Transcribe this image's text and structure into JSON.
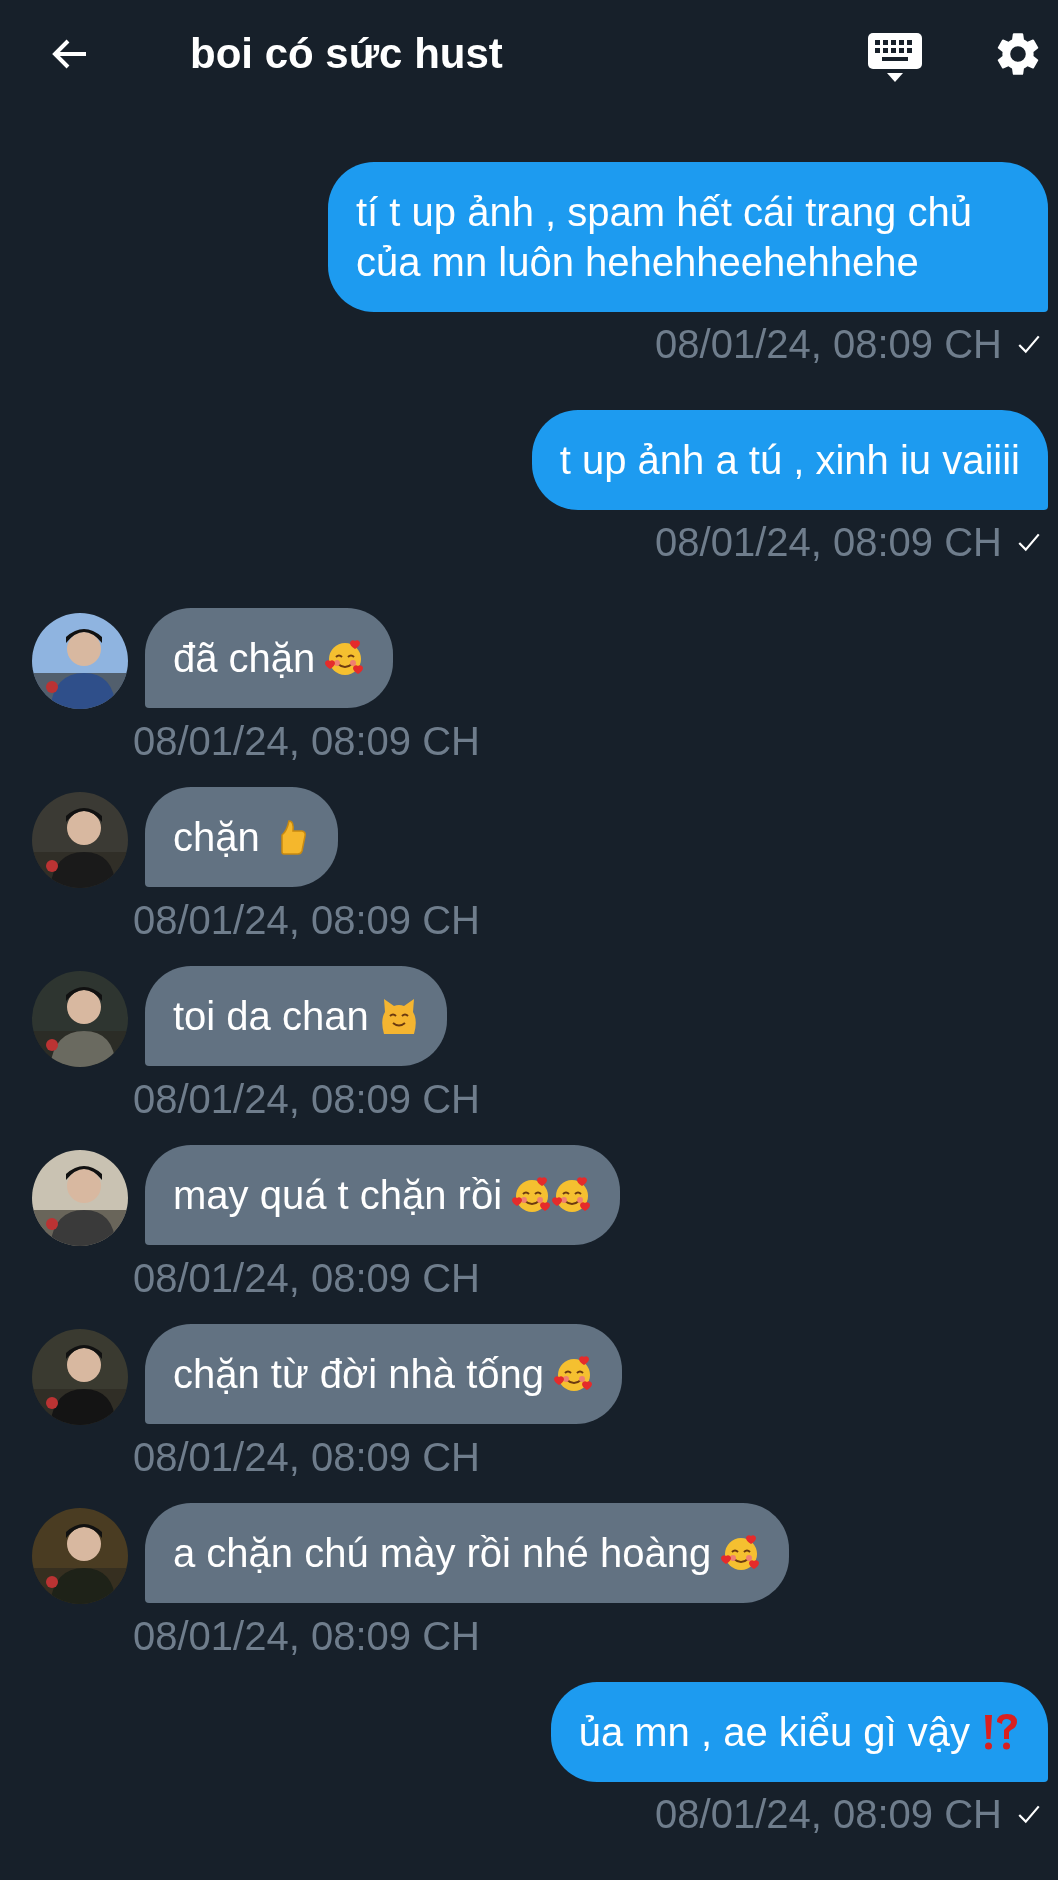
{
  "header": {
    "title": "boi có sức hust"
  },
  "messages": [
    {
      "kind": "outgoing",
      "text": "tí t up ảnh , spam hết cái trang chủ của mn luôn hehehheehehhehe",
      "time": "08/01/24, 08:09 CH",
      "check": true
    },
    {
      "kind": "outgoing",
      "text": "t up ảnh a tú , xinh iu vaiiii",
      "time": "08/01/24, 08:09 CH",
      "check": true
    },
    {
      "kind": "incoming",
      "text": "đã chặn",
      "emojis": [
        {
          "kind": "hearts-face"
        }
      ],
      "avatar": {
        "kind": "picture"
      },
      "time": "08/01/24, 08:09 CH"
    },
    {
      "kind": "incoming",
      "text": "chặn",
      "emojis": [
        {
          "kind": "thumbs-up"
        }
      ],
      "avatar": {
        "kind": "picture"
      },
      "time": "08/01/24, 08:09 CH"
    },
    {
      "kind": "incoming",
      "text": "toi da chan",
      "emojis": [
        {
          "kind": "cat-face"
        }
      ],
      "avatar": {
        "kind": "picture"
      },
      "time": "08/01/24, 08:09 CH"
    },
    {
      "kind": "incoming",
      "text": "may quá t chặn rồi",
      "emojis": [
        {
          "kind": "hearts-face"
        },
        {
          "kind": "hearts-face"
        }
      ],
      "avatar": {
        "kind": "picture"
      },
      "time": "08/01/24, 08:09 CH"
    },
    {
      "kind": "incoming",
      "text": "chặn từ đời nhà tống",
      "emojis": [
        {
          "kind": "hearts-face"
        }
      ],
      "avatar": {
        "kind": "picture"
      },
      "time": "08/01/24, 08:09 CH"
    },
    {
      "kind": "incoming",
      "text": "a chặn chú mày rồi nhé hoàng",
      "emojis": [
        {
          "kind": "hearts-face"
        }
      ],
      "avatar": {
        "kind": "picture"
      },
      "time": "08/01/24, 08:09 CH"
    },
    {
      "kind": "outgoing",
      "text": "ủa mn , ae kiểu gì vậy",
      "emojis": [
        {
          "kind": "exclamation-question"
        }
      ],
      "time": "08/01/24, 08:09 CH",
      "check": true
    }
  ]
}
